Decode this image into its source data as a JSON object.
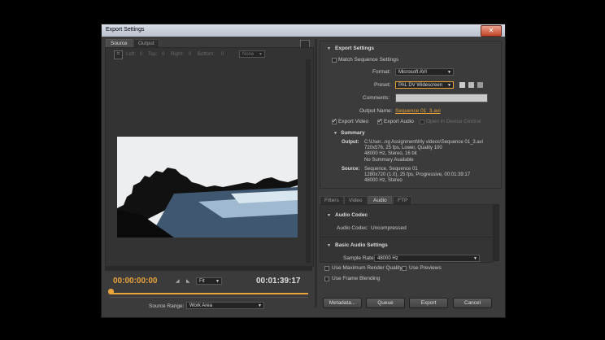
{
  "window": {
    "title": "Export Settings",
    "close_glyph": "✕"
  },
  "source_tabs": {
    "source": "Source",
    "output": "Output"
  },
  "crop_toolbar": {
    "left": "Left:",
    "left_val": "0",
    "top": "Top:",
    "top_val": "0",
    "right": "Right:",
    "right_val": "0",
    "bottom": "Bottom:",
    "bottom_val": "0",
    "scale": "None"
  },
  "timeline": {
    "current": "00:00:00:00",
    "fit": "Fit",
    "duration": "00:01:39:17",
    "progress": 0.0
  },
  "source_range": {
    "label": "Source Range:",
    "value": "Work Area"
  },
  "export_settings": {
    "heading": "Export Settings",
    "match_sequence": "Match Sequence Settings",
    "format_label": "Format:",
    "format_value": "Microsoft AVI",
    "preset_label": "Preset:",
    "preset_value": "PAL DV Widescreen",
    "comments_label": "Comments:",
    "comments_value": "",
    "output_name_label": "Output Name:",
    "output_name_value": "Sequence 01_3.avi",
    "export_video": "Export Video",
    "export_audio": "Export Audio",
    "device_central": "Open in Device Central"
  },
  "summary": {
    "heading": "Summary",
    "output_label": "Output:",
    "output_lines": [
      "C:\\User...ng Assignment\\My videos\\Sequence 01_3.avi",
      "720x576, 25 fps, Lower, Quality 100",
      "48000 Hz, Stereo, 16 bit",
      "No Summary Available"
    ],
    "source_label": "Source:",
    "source_lines": [
      "Sequence, Sequence 01",
      "1280x720 (1.0), 25 fps, Progressive, 00:01:39:17",
      "48000 Hz, Stereo"
    ]
  },
  "settings_tabs": [
    "Filters",
    "Video",
    "Audio",
    "FTP"
  ],
  "audio": {
    "codec_heading": "Audio Codec",
    "codec_label": "Audio Codec:",
    "codec_value": "Uncompressed",
    "basic_heading": "Basic Audio Settings",
    "sample_rate_label": "Sample Rate:",
    "sample_rate_value": "48000 Hz"
  },
  "options": {
    "max_render": "Use Maximum Render Quality",
    "previews": "Use Previews",
    "frame_blending": "Use Frame Blending"
  },
  "buttons": {
    "metadata": "Metadata...",
    "queue": "Queue",
    "export": "Export",
    "cancel": "Cancel"
  },
  "colors": {
    "accent": "#e8a33b",
    "panel_bg": "#3b3b3b",
    "title_bar": "#c8cfda"
  }
}
